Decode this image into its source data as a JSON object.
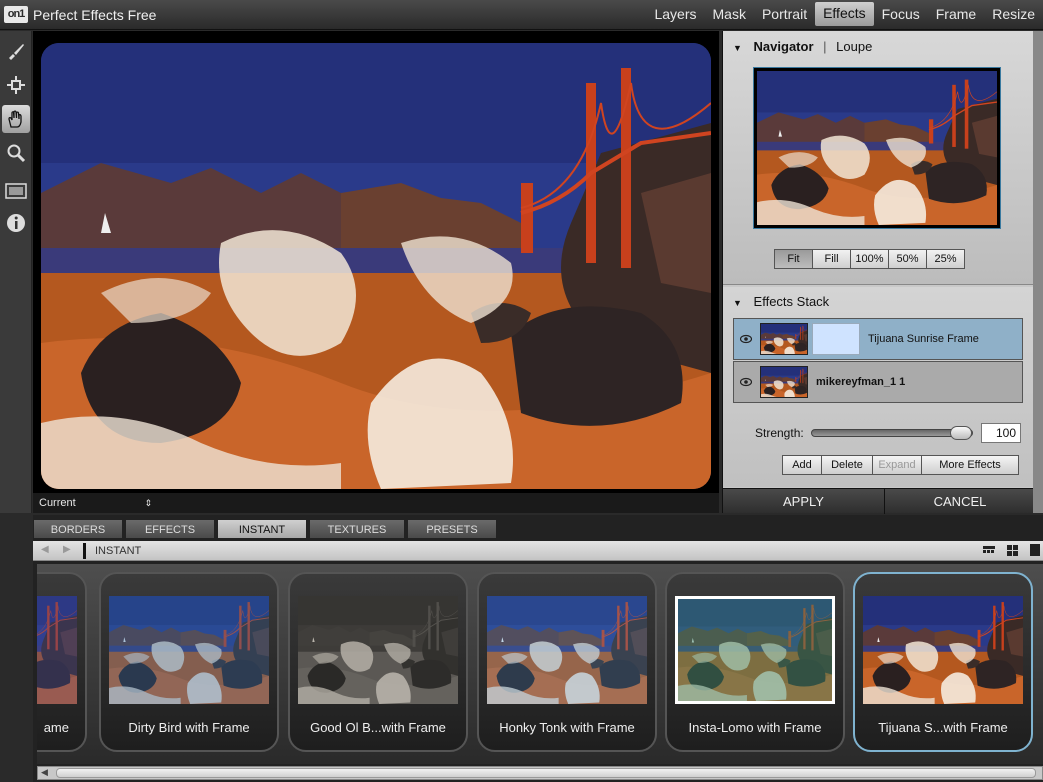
{
  "app": {
    "logo_text": "on1",
    "title": "Perfect Effects Free"
  },
  "modules": [
    {
      "label": "Layers"
    },
    {
      "label": "Mask"
    },
    {
      "label": "Portrait"
    },
    {
      "label": "Effects",
      "active": true
    },
    {
      "label": "Focus"
    },
    {
      "label": "Frame"
    },
    {
      "label": "Resize"
    }
  ],
  "tools": [
    "brush-icon",
    "transform-icon",
    "hand-icon",
    "zoom-icon",
    "compare-icon",
    "info-icon"
  ],
  "canvas": {
    "view_mode": "Current"
  },
  "navigator": {
    "title": "Navigator",
    "alt_tab": "Loupe",
    "zoom_buttons": [
      {
        "label": "Fit",
        "active": true
      },
      {
        "label": "Fill"
      },
      {
        "label": "100%"
      },
      {
        "label": "50%"
      },
      {
        "label": "25%"
      }
    ]
  },
  "effects_stack": {
    "title": "Effects Stack",
    "layers": [
      {
        "name": "Tijuana Sunrise Frame",
        "selected": true
      },
      {
        "name": "mikereyfman_1 1",
        "selected": false
      }
    ],
    "strength_label": "Strength:",
    "strength_value": "100",
    "buttons": [
      {
        "label": "Add"
      },
      {
        "label": "Delete"
      },
      {
        "label": "Expand",
        "disabled": true
      },
      {
        "label": "More Effects"
      }
    ]
  },
  "actions": {
    "apply": "APPLY",
    "cancel": "CANCEL"
  },
  "browser": {
    "tabs": [
      {
        "label": "BORDERS"
      },
      {
        "label": "EFFECTS"
      },
      {
        "label": "INSTANT",
        "active": true
      },
      {
        "label": "TEXTURES"
      },
      {
        "label": "PRESETS"
      }
    ],
    "breadcrumb": "INSTANT",
    "presets": [
      {
        "label": "ame"
      },
      {
        "label": "Dirty Bird with Frame"
      },
      {
        "label": "Good Ol B...with Frame"
      },
      {
        "label": "Honky Tonk with Frame"
      },
      {
        "label": "Insta-Lomo with Frame"
      },
      {
        "label": "Tijuana S...with Frame",
        "active": true
      }
    ]
  },
  "colors": {
    "accent": "#7fb3d0",
    "selected_layer": "#8fb0c8"
  }
}
